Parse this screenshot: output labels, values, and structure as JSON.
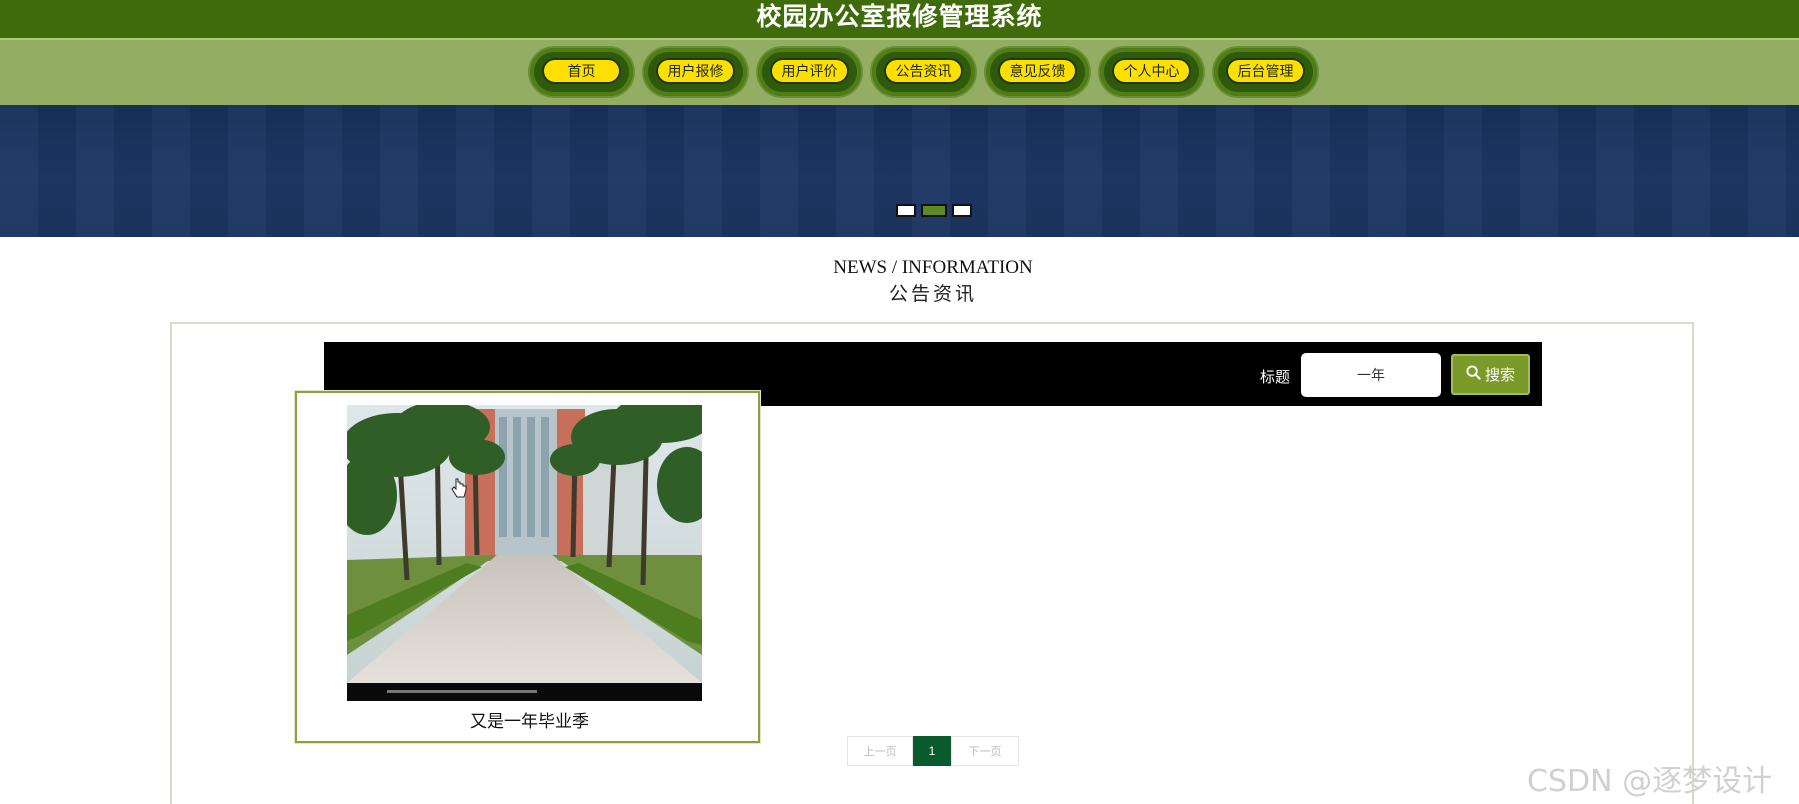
{
  "header": {
    "title": "校园办公室报修管理系统"
  },
  "nav": {
    "items": [
      {
        "label": "首页"
      },
      {
        "label": "用户报修"
      },
      {
        "label": "用户评价"
      },
      {
        "label": "公告资讯"
      },
      {
        "label": "意见反馈"
      },
      {
        "label": "个人中心"
      },
      {
        "label": "后台管理"
      }
    ]
  },
  "banner": {
    "slide_count": 3,
    "active_slide": 2
  },
  "section": {
    "title_en": "NEWS / INFORMATION",
    "title_cn": "公告资讯"
  },
  "search": {
    "label": "标题",
    "value": "一年",
    "button_label": "搜索",
    "button_icon": "search-icon"
  },
  "news": [
    {
      "title": "又是一年毕业季",
      "image": "campus-avenue-photo"
    }
  ],
  "pagination": {
    "prev_label": "上一页",
    "current_page": "1",
    "next_label": "下一页"
  },
  "watermark": "CSDN @逐梦设计",
  "colors": {
    "header_bg": "#3f6b0a",
    "nav_bg": "#93ad63",
    "nav_pill": "#ffdf00",
    "banner_bg": "#1e3766",
    "accent": "#7a9a2a",
    "page_active": "#0b5a2e"
  }
}
